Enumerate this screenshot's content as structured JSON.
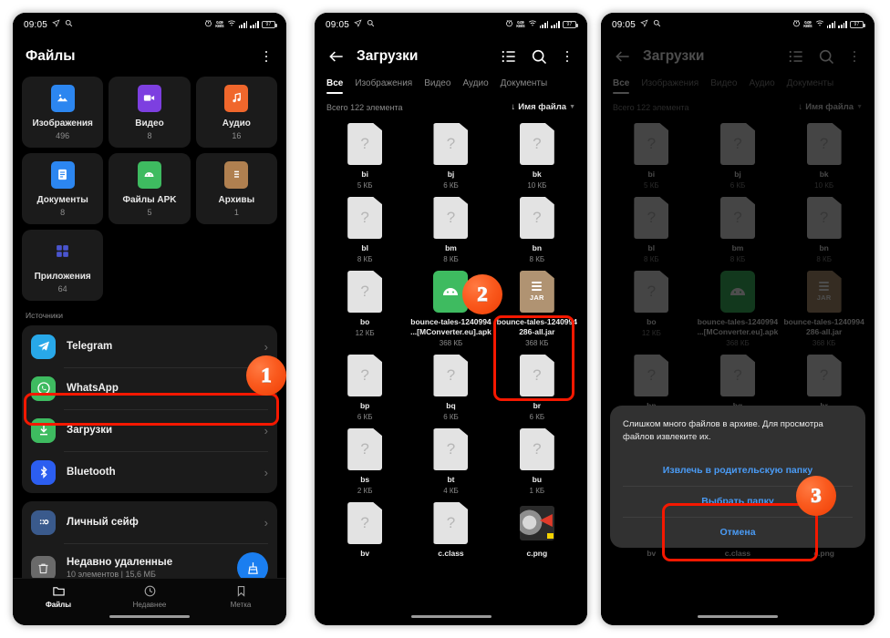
{
  "statusbar": {
    "time": "09:05",
    "nav_icon": "location-icon",
    "search_icon": "search-icon",
    "alarm_icon": "alarm-icon",
    "net_speed_value": "0.09",
    "net_speed_unit": "KB/S",
    "wifi_icon": "wifi-icon",
    "signal_icon": "signal-bars-icon",
    "battery_level": "97"
  },
  "panel1": {
    "appbar": {
      "title": "Файлы",
      "menu_icon": "kebab-menu-icon"
    },
    "categories": [
      {
        "label": "Изображения",
        "count": "496",
        "icon": "image-icon",
        "color": "#2c86f0"
      },
      {
        "label": "Видео",
        "count": "8",
        "icon": "video-icon",
        "color": "#7d3fe0"
      },
      {
        "label": "Аудио",
        "count": "16",
        "icon": "audio-icon",
        "color": "#f0672c"
      },
      {
        "label": "Документы",
        "count": "8",
        "icon": "document-icon",
        "color": "#2c86f0"
      },
      {
        "label": "Файлы APK",
        "count": "5",
        "icon": "apk-icon",
        "color": "#3ebb60"
      },
      {
        "label": "Архивы",
        "count": "1",
        "icon": "archive-icon",
        "color": "#b08050"
      },
      {
        "label": "Приложения",
        "count": "64",
        "icon": "apps-grid-icon",
        "color": "#3b4cc0"
      }
    ],
    "sources_header": "Источники",
    "sources": [
      {
        "label": "Telegram",
        "icon": "telegram-icon",
        "color": "#28a8e9"
      },
      {
        "label": "WhatsApp",
        "icon": "whatsapp-icon",
        "color": "#3ebb60"
      },
      {
        "label": "Загрузки",
        "icon": "download-icon",
        "color": "#3ebb60"
      },
      {
        "label": "Bluetooth",
        "icon": "bluetooth-icon",
        "color": "#2c5ef0"
      }
    ],
    "extras": [
      {
        "label": "Личный сейф",
        "sub": "",
        "icon": "safe-icon",
        "color": "#3a5a8c"
      },
      {
        "label": "Недавно удаленные",
        "sub": "10 элементов  |  15,6 МБ",
        "icon": "trash-icon",
        "color": "#6a6a6a"
      }
    ],
    "clean_button_icon": "broom-icon",
    "bottom_nav": [
      {
        "label": "Файлы",
        "icon": "folder-icon",
        "active": true
      },
      {
        "label": "Недавнее",
        "icon": "clock-icon",
        "active": false
      },
      {
        "label": "Метка",
        "icon": "bookmark-icon",
        "active": false
      }
    ]
  },
  "panel2": {
    "appbar": {
      "title": "Загрузки",
      "back_icon": "back-arrow-icon",
      "list_icon": "list-view-icon",
      "search_icon": "search-icon",
      "menu_icon": "kebab-menu-icon"
    },
    "tabs": [
      {
        "label": "Все",
        "active": true
      },
      {
        "label": "Изображения",
        "active": false
      },
      {
        "label": "Видео",
        "active": false
      },
      {
        "label": "Аудио",
        "active": false
      },
      {
        "label": "Документы",
        "active": false
      }
    ],
    "total_text": "Всего 122 элемента",
    "sort_label": "Имя файла",
    "sort_arrow": "↓",
    "sort_caret_icon": "chevron-down-icon",
    "files": [
      {
        "name": "bi",
        "size": "5 КБ",
        "type": "unknown"
      },
      {
        "name": "bj",
        "size": "6 КБ",
        "type": "unknown"
      },
      {
        "name": "bk",
        "size": "10 КБ",
        "type": "unknown"
      },
      {
        "name": "bl",
        "size": "8 КБ",
        "type": "unknown"
      },
      {
        "name": "bm",
        "size": "8 КБ",
        "type": "unknown"
      },
      {
        "name": "bn",
        "size": "8 КБ",
        "type": "unknown"
      },
      {
        "name": "bo",
        "size": "12 КБ",
        "type": "unknown"
      },
      {
        "name": "bounce-tales-1240994 ...[MConverter.eu].apk",
        "size": "368 КБ",
        "type": "apk"
      },
      {
        "name": "bounce-tales-1240994 286-all.jar",
        "size": "368 КБ",
        "type": "jar"
      },
      {
        "name": "bp",
        "size": "6 КБ",
        "type": "unknown"
      },
      {
        "name": "bq",
        "size": "6 КБ",
        "type": "unknown"
      },
      {
        "name": "br",
        "size": "6 КБ",
        "type": "unknown"
      },
      {
        "name": "bs",
        "size": "2 КБ",
        "type": "unknown"
      },
      {
        "name": "bt",
        "size": "4 КБ",
        "type": "unknown"
      },
      {
        "name": "bu",
        "size": "1 КБ",
        "type": "unknown"
      },
      {
        "name": "bv",
        "size": "",
        "type": "unknown"
      },
      {
        "name": "c.class",
        "size": "",
        "type": "unknown"
      },
      {
        "name": "c.png",
        "size": "",
        "type": "image"
      }
    ],
    "jar_icon_text": "JAR"
  },
  "panel3": {
    "dialog": {
      "message": "Слишком много файлов в архиве. Для просмотра файлов извлеките их.",
      "buttons": [
        {
          "label": "Извлечь в родительскую папку",
          "highlighted": true
        },
        {
          "label": "Выбрать папку",
          "highlighted": true
        },
        {
          "label": "Отмена",
          "highlighted": false
        }
      ]
    }
  },
  "annotations": {
    "badges": [
      {
        "number": "1",
        "target": "downloads-source-row"
      },
      {
        "number": "2",
        "target": "jar-file-tile"
      },
      {
        "number": "3",
        "target": "extract-dialog-buttons"
      }
    ],
    "highlight_color": "#f51800"
  }
}
